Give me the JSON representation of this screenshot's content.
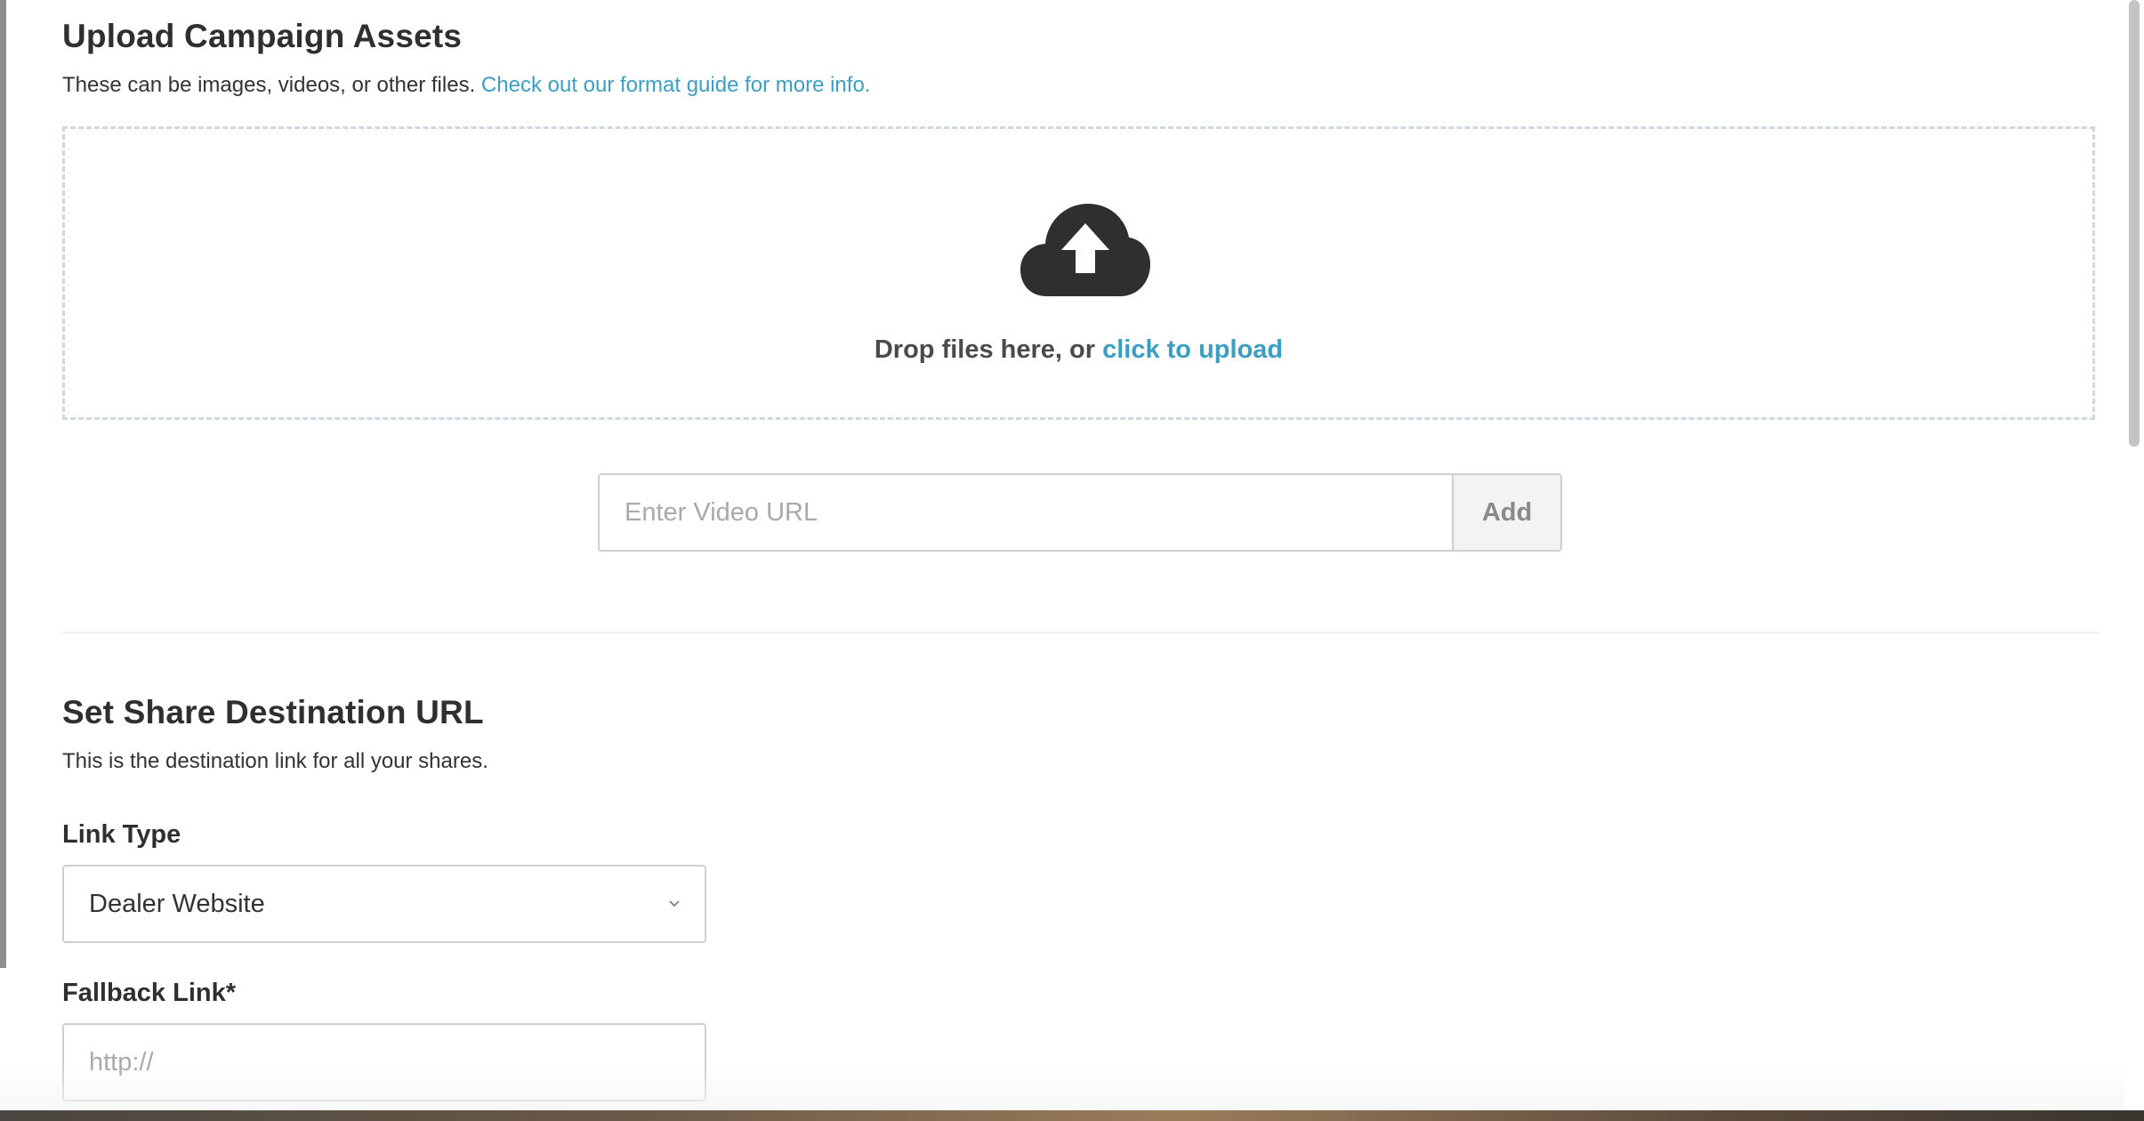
{
  "upload_section": {
    "title": "Upload Campaign Assets",
    "description": "These can be images, videos, or other files.",
    "format_guide_link": "Check out our format guide for more info.",
    "dropzone": {
      "icon": "cloud-upload-icon",
      "text": "Drop files here, or",
      "upload_link": "click to upload"
    },
    "video_url": {
      "placeholder": "Enter Video URL",
      "value": "",
      "add_label": "Add"
    }
  },
  "share_section": {
    "title": "Set Share Destination URL",
    "description": "This is the destination link for all your shares.",
    "link_type": {
      "label": "Link Type",
      "selected": "Dealer Website",
      "chevron_icon": "chevron-down-icon"
    },
    "fallback_link": {
      "label": "Fallback Link*",
      "placeholder": "http://",
      "value": ""
    }
  },
  "colors": {
    "link": "#3d9ec4",
    "heading": "#2f2f2f",
    "dropzone_border": "#cfd9e0",
    "icon": "#2f2f2f"
  }
}
